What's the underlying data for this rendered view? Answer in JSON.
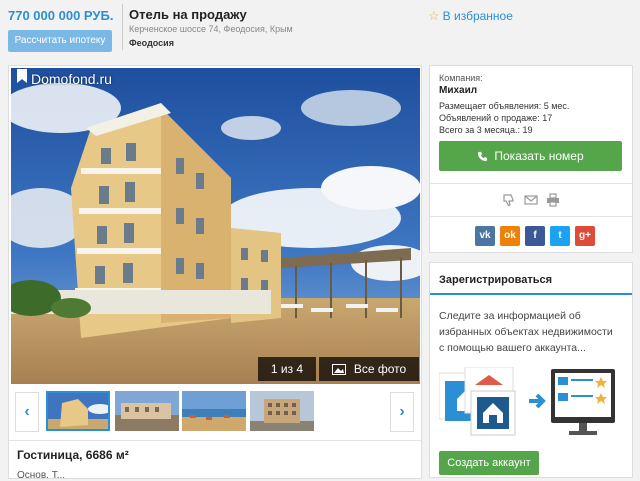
{
  "header": {
    "price": "770 000 000 РУБ.",
    "mortgage_button": "Рассчитать ипотеку",
    "title": "Отель на продажу",
    "address": "Керченское шоссе 74, Феодосия, Крым",
    "city": "Феодосия",
    "favorite_label": "В избранное"
  },
  "gallery": {
    "brand": "Domofond.ru",
    "counter": "1 из 4",
    "all_photos": "Все фото",
    "prev_icon": "chevron-left-icon",
    "next_icon": "chevron-right-icon",
    "thumbnails": [
      "photo-1",
      "photo-2",
      "photo-3",
      "photo-4"
    ],
    "selected_index": 0
  },
  "listing": {
    "area_title": "Гостиница, 6686 м²",
    "next_line": "Основ.  Т..."
  },
  "seller": {
    "company_label": "Компания:",
    "name": "Михаил",
    "posting_since": "Размещает объявления: 5 мес.",
    "ads_for_sale": "Объявлений о продаже: 17",
    "total_3_months": "Всего за 3 месяца.: 19",
    "show_phone_button": "Показать номер",
    "tools": [
      "thumbs-down-icon",
      "envelope-icon",
      "print-icon"
    ],
    "socials": [
      {
        "name": "vk",
        "label": "vk",
        "color": "#4c75a3"
      },
      {
        "name": "ok",
        "label": "ok",
        "color": "#ee8208"
      },
      {
        "name": "facebook",
        "label": "f",
        "color": "#3b5998"
      },
      {
        "name": "twitter",
        "label": "t",
        "color": "#1da1f2"
      },
      {
        "name": "google-plus",
        "label": "g+",
        "color": "#dd4b39"
      }
    ]
  },
  "register": {
    "title": "Зарегистрироваться",
    "text": "Следите за информацией об избранных объектах недвижимости с помощью вашего аккаунта...",
    "create_button": "Создать аккаунт"
  },
  "colors": {
    "accent": "#2b8fd6",
    "green": "#55a64a",
    "star": "#f0b43a"
  }
}
